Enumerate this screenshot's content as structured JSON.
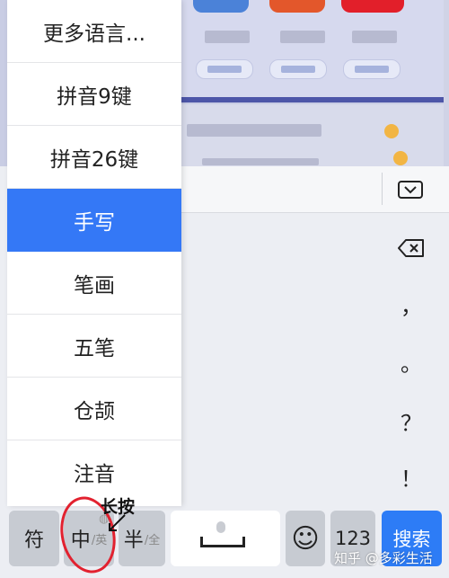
{
  "language_menu": {
    "items": [
      {
        "label": "更多语言..."
      },
      {
        "label": "拼音9键"
      },
      {
        "label": "拼音26键"
      },
      {
        "label": "手写",
        "selected": true
      },
      {
        "label": "笔画"
      },
      {
        "label": "五笔"
      },
      {
        "label": "仓颉"
      },
      {
        "label": "注音"
      }
    ]
  },
  "side_keys": {
    "comma": "，",
    "period": "。",
    "question": "？",
    "exclaim": "！"
  },
  "bottom_row": {
    "symbol_label": "符",
    "lang_main": "中",
    "lang_sub": "/英",
    "width_main": "半",
    "width_sub": "/全",
    "emoji_label": "☺",
    "numbers_label": "123",
    "search_label": "搜索"
  },
  "annotation": {
    "long_press": "长按"
  },
  "watermark": "知乎 @多彩生活",
  "colors": {
    "selected_blue": "#3478f6",
    "search_key_blue": "#2d7cf6",
    "annotation_red": "#e2212f"
  },
  "icons": [
    "chevron-down-icon",
    "backspace-icon",
    "microphone-icon",
    "globe-icon",
    "emoji-icon"
  ]
}
